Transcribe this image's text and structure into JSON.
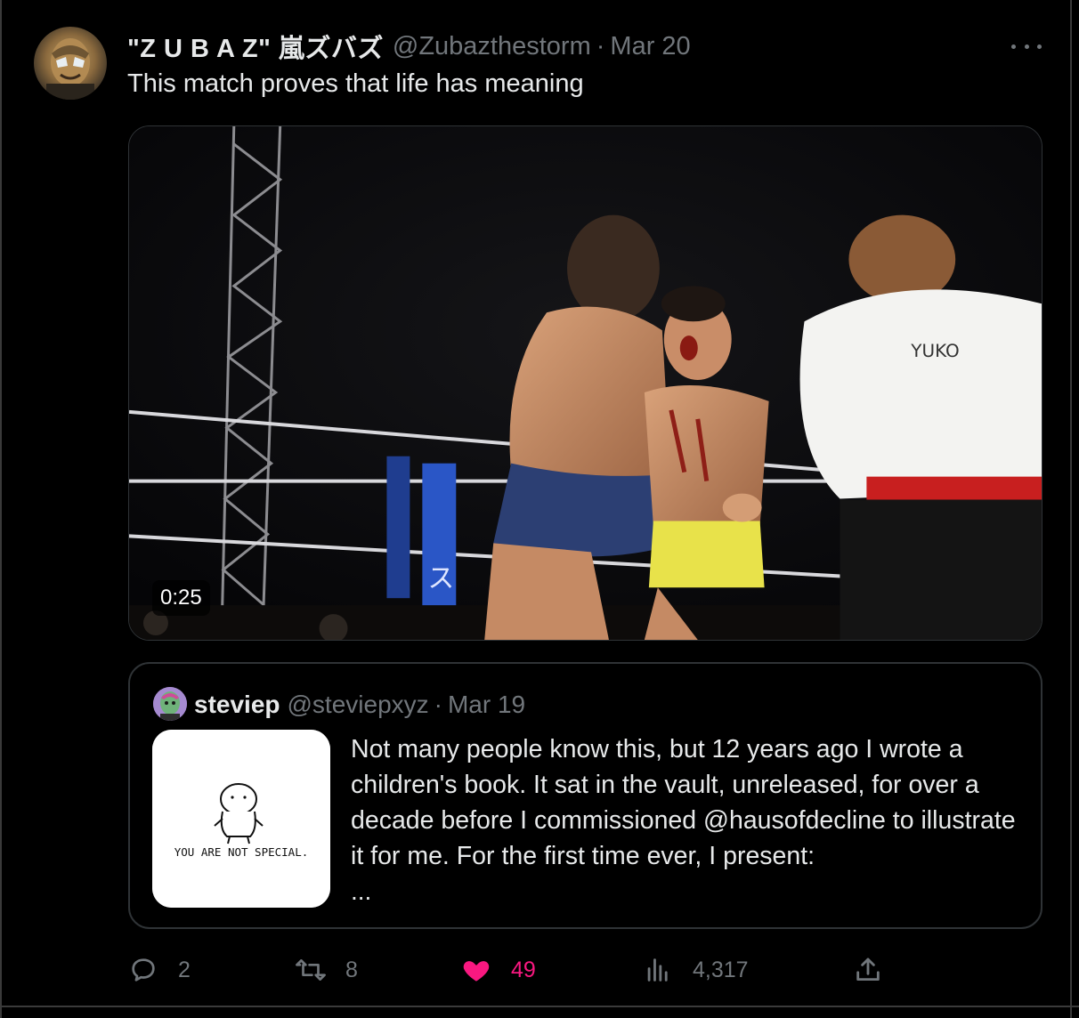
{
  "tweet": {
    "display_name": "\"Z U B A Z\" 嵐ズバズ",
    "handle": "@Zubazthestorm",
    "separator": "·",
    "time": "Mar 20",
    "text": "This match proves that life has meaning",
    "media": {
      "duration": "0:25",
      "ring_mat_text": "YUKO"
    }
  },
  "quote": {
    "display_name": "steviep",
    "handle": "@steviepxyz",
    "separator": "·",
    "time": "Mar 19",
    "thumbnail_caption": "YOU ARE NOT SPECIAL.",
    "text": "Not many people know this, but 12 years ago I wrote a children's book. It sat in the vault, unreleased, for over a decade before I commissioned @hausofdecline to illustrate it for me. For the first time ever, I present:",
    "more": "..."
  },
  "actions": {
    "replies": "2",
    "retweets": "8",
    "likes": "49",
    "views": "4,317"
  },
  "colors": {
    "background": "#000000",
    "text_primary": "#e7e9ea",
    "text_secondary": "#71767b",
    "border": "#2f3336",
    "like": "#f91880"
  }
}
